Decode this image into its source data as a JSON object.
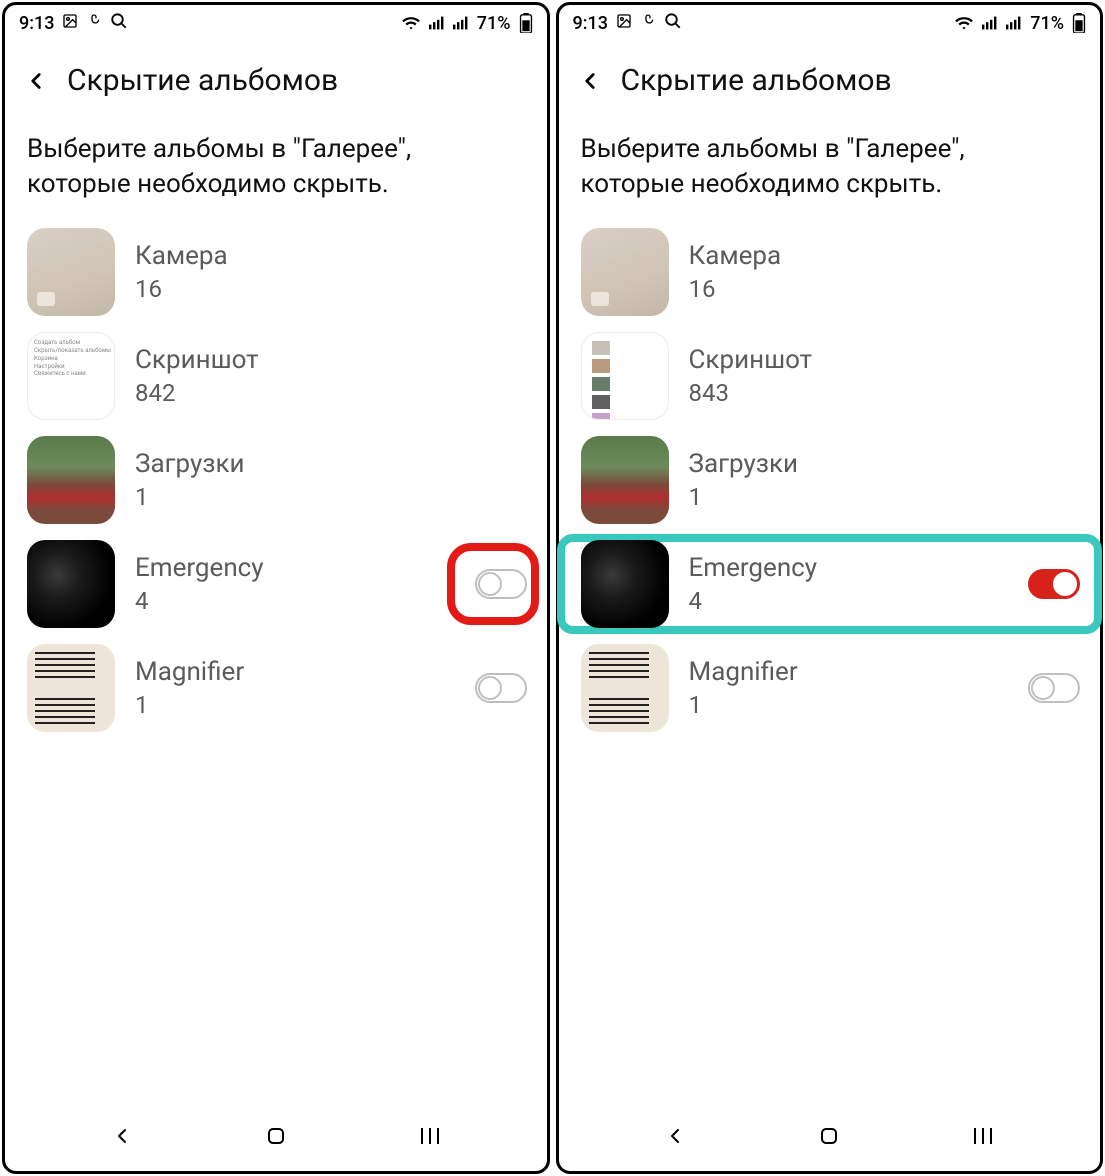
{
  "statusbar": {
    "time": "9:13",
    "battery": "71%"
  },
  "header": {
    "title": "Скрытие альбомов"
  },
  "subtitle_line1": "Выберите альбомы в \"Галерее\",",
  "subtitle_line2": "которые необходимо скрыть.",
  "screens": [
    {
      "albums": [
        {
          "name": "Камера",
          "count": "16",
          "thumb": "camera",
          "toggle": null
        },
        {
          "name": "Скриншот",
          "count": "842",
          "thumb": "shot",
          "toggle": null
        },
        {
          "name": "Загрузки",
          "count": "1",
          "thumb": "down",
          "toggle": null
        },
        {
          "name": "Emergency",
          "count": "4",
          "thumb": "emer",
          "toggle": "off",
          "highlight": "red"
        },
        {
          "name": "Magnifier",
          "count": "1",
          "thumb": "mag",
          "toggle": "off"
        }
      ]
    },
    {
      "albums": [
        {
          "name": "Камера",
          "count": "16",
          "thumb": "camera",
          "toggle": null
        },
        {
          "name": "Скриншот",
          "count": "843",
          "thumb": "shot2",
          "toggle": null
        },
        {
          "name": "Загрузки",
          "count": "1",
          "thumb": "down",
          "toggle": null
        },
        {
          "name": "Emergency",
          "count": "4",
          "thumb": "emer",
          "toggle": "on",
          "highlight": "teal"
        },
        {
          "name": "Magnifier",
          "count": "1",
          "thumb": "mag",
          "toggle": "off"
        }
      ]
    }
  ]
}
